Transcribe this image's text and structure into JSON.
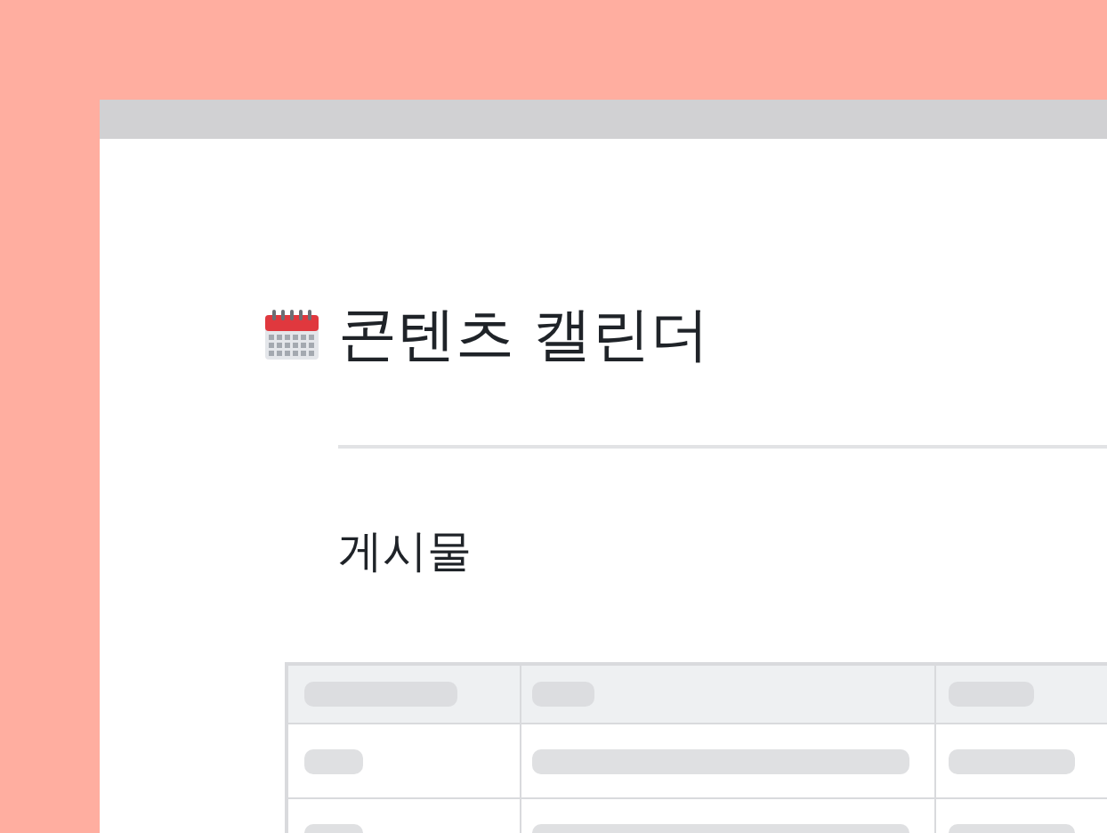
{
  "page": {
    "title": "콘텐츠 캘린더",
    "section_heading": "게시물"
  },
  "table": {
    "columns": [
      {
        "kind": "skeleton"
      },
      {
        "kind": "skeleton"
      },
      {
        "kind": "skeleton"
      }
    ],
    "rows": [
      {
        "cells": [
          {
            "kind": "skeleton"
          },
          {
            "kind": "skeleton"
          },
          {
            "kind": "skeleton"
          }
        ]
      },
      {
        "cells": [
          {
            "kind": "skeleton"
          },
          {
            "kind": "skeleton"
          },
          {
            "kind": "skeleton"
          }
        ]
      }
    ]
  }
}
